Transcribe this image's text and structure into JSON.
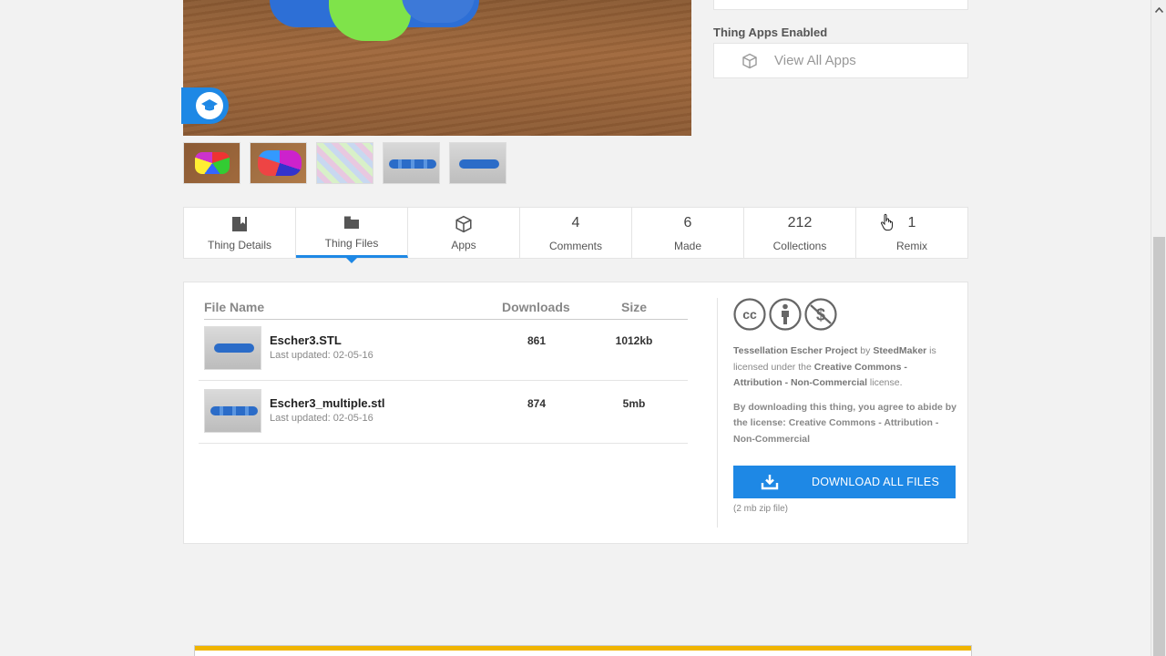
{
  "sidebar": {
    "apps_title": "Thing Apps Enabled",
    "view_apps_label": "View All Apps"
  },
  "tabs": [
    {
      "icon": "bookmark-icon",
      "label": "Thing Details",
      "count": null,
      "active": false
    },
    {
      "icon": "folder-icon",
      "label": "Thing Files",
      "count": null,
      "active": true
    },
    {
      "icon": "cube-icon",
      "label": "Apps",
      "count": null,
      "active": false
    },
    {
      "icon": null,
      "label": "Comments",
      "count": "4",
      "active": false
    },
    {
      "icon": null,
      "label": "Made",
      "count": "6",
      "active": false
    },
    {
      "icon": null,
      "label": "Collections",
      "count": "212",
      "active": false
    },
    {
      "icon": null,
      "label": "Remix",
      "count": "1",
      "active": false
    }
  ],
  "files": {
    "headers": {
      "name": "File Name",
      "downloads": "Downloads",
      "size": "Size"
    },
    "rows": [
      {
        "name": "Escher3.STL",
        "updated": "Last updated: 02-05-16",
        "downloads": "861",
        "size": "1012kb"
      },
      {
        "name": "Escher3_multiple.stl",
        "updated": "Last updated: 02-05-16",
        "downloads": "874",
        "size": "5mb"
      }
    ]
  },
  "license": {
    "thing_name": "Tessellation Escher Project",
    "by": " by ",
    "author": "SteedMaker",
    "is_licensed": " is licensed under the ",
    "license_name": "Creative Commons - Attribution - Non-Commercial",
    "license_suffix": " license.",
    "agreement": "By downloading this thing, you agree to abide by the license: Creative Commons - Attribution - Non-Commercial",
    "download_label": "DOWNLOAD ALL FILES",
    "zip_note": "(2 mb zip file)"
  },
  "colors": {
    "accent": "#1e88e5",
    "banner": "#f0b400"
  }
}
